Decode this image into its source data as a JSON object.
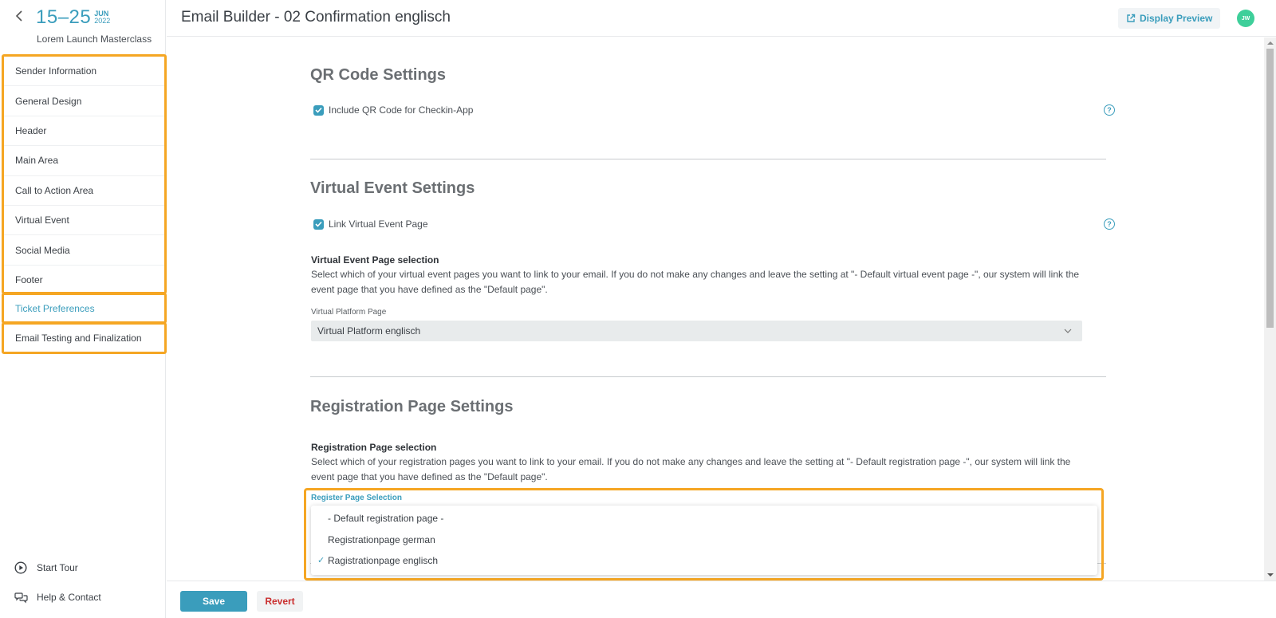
{
  "event": {
    "back_icon": "chevron-left-icon",
    "date_range": "15–25",
    "month": "JUN",
    "year": "2022",
    "name": "Lorem Launch Masterclass"
  },
  "sidebar": {
    "group1": [
      {
        "label": "Sender Information"
      },
      {
        "label": "General Design"
      },
      {
        "label": "Header"
      },
      {
        "label": "Main Area"
      },
      {
        "label": "Call to Action Area"
      },
      {
        "label": "Virtual Event"
      },
      {
        "label": "Social Media"
      },
      {
        "label": "Footer"
      }
    ],
    "ticket_preferences": "Ticket Preferences",
    "email_testing": "Email Testing and Finalization",
    "start_tour": "Start Tour",
    "help_contact": "Help & Contact"
  },
  "header": {
    "title": "Email Builder - 02 Confirmation englisch",
    "preview_label": "Display Preview",
    "avatar_initials": "JW"
  },
  "qr": {
    "title": "QR Code Settings",
    "checkbox_label": "Include QR Code for Checkin-App",
    "checked": true
  },
  "virtual": {
    "title": "Virtual Event Settings",
    "checkbox_label": "Link Virtual Event Page",
    "checked": true,
    "selection_title": "Virtual Event Page selection",
    "description": "Select which of your virtual event pages you want to link to your email. If you do not make any changes and leave the setting at \"- Default virtual event page -\", our system will link the event page that you have defined as the \"Default page\".",
    "field_label": "Virtual Platform Page",
    "selected": "Virtual Platform englisch"
  },
  "registration": {
    "title": "Registration Page Settings",
    "selection_title": "Registration Page selection",
    "description": "Select which of your registration pages you want to link to your email. If you do not make any changes and leave the setting at \"- Default registration page -\", our system will link the event page that you have defined as the \"Default page\".",
    "field_label": "Register Page Selection",
    "options": [
      {
        "label": "- Default registration page -",
        "selected": false
      },
      {
        "label": "Registrationpage german",
        "selected": false
      },
      {
        "label": "Ragistrationpage englisch",
        "selected": true
      }
    ],
    "check_mark": "✓"
  },
  "footer": {
    "save_label": "Save",
    "revert_label": "Revert"
  },
  "colors": {
    "accent": "#3a9dbc",
    "highlight": "#f5a623",
    "danger": "#c92d2d",
    "avatar": "#3ecf9a"
  }
}
